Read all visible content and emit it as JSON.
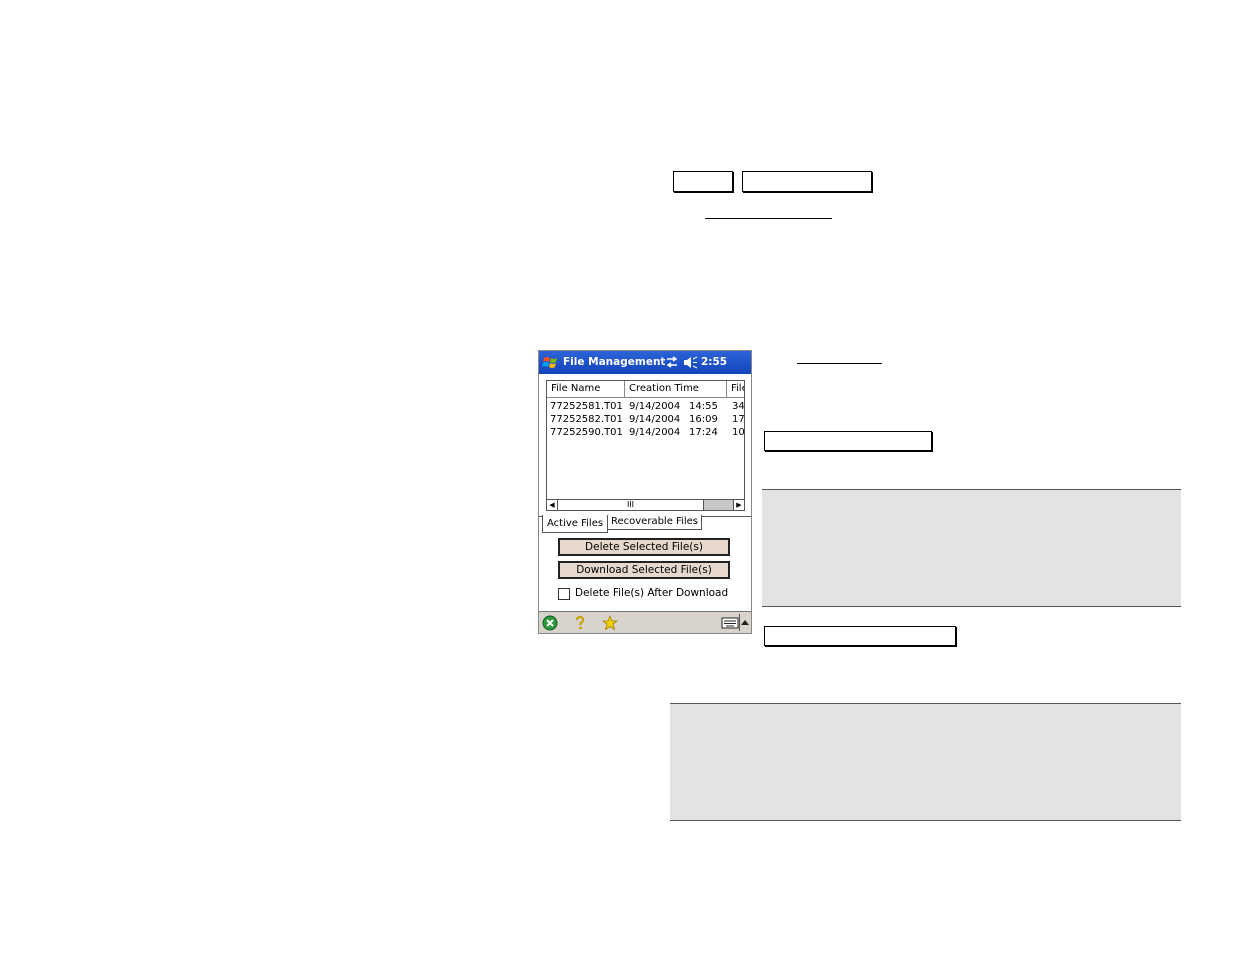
{
  "pda": {
    "title": "File Management",
    "clock": "2:55",
    "columns": [
      "File Name",
      "Creation Time",
      "File"
    ],
    "rows": [
      {
        "name": "77252581.T01",
        "date": "9/14/2004",
        "time": "14:55",
        "size": "34"
      },
      {
        "name": "77252582.T01",
        "date": "9/14/2004",
        "time": "16:09",
        "size": "17"
      },
      {
        "name": "77252590.T01",
        "date": "9/14/2004",
        "time": "17:24",
        "size": "10"
      }
    ],
    "scroll_thumb": "III",
    "tabs": [
      "Active Files",
      "Recoverable Files"
    ],
    "delete_button": "Delete Selected File(s)",
    "download_button": "Download Selected File(s)",
    "checkbox_label": "Delete File(s) After Download",
    "checkbox_checked": false,
    "icons": {
      "start": "windows-flag-icon",
      "sync": "sync-arrows-icon",
      "volume": "speaker-icon",
      "close": "close-icon",
      "help": "help-icon",
      "favorites": "favorites-icon",
      "keyboard": "keyboard-icon"
    }
  }
}
